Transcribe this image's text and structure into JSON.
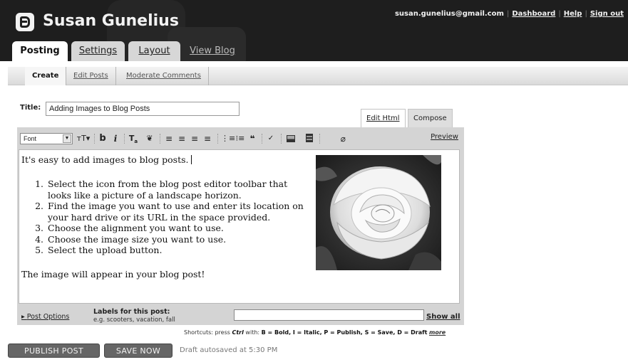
{
  "header": {
    "blog_title": "Susan Gunelius",
    "email": "susan.gunelius@gmail.com",
    "links": [
      "Dashboard",
      "Help",
      "Sign out"
    ]
  },
  "tabs": [
    "Posting",
    "Settings",
    "Layout",
    "View Blog"
  ],
  "subtabs": [
    "Create",
    "Edit Posts",
    "Moderate Comments"
  ],
  "title_field": {
    "label": "Title:",
    "value": "Adding Images to Blog Posts"
  },
  "editor_modes": [
    "Edit Html",
    "Compose"
  ],
  "toolbar": {
    "font": "Font",
    "preview": "Preview"
  },
  "post": {
    "intro": "It's easy to add images to blog posts.",
    "steps": [
      "Select the icon from the blog post editor toolbar that looks like a picture of a landscape horizon.",
      "Find the image you want to use and enter its location on your hard drive or its URL in the space provided.",
      "Choose the alignment you want to use.",
      "Choose the image size you want to use.",
      "Select the upload button."
    ],
    "outro": "The image will appear in your blog post!"
  },
  "bottom": {
    "post_options": "Post Options",
    "labels_title": "Labels for this post:",
    "labels_hint": "e.g. scooters, vacation, fall",
    "show_all": "Show all",
    "shortcuts_prefix": "Shortcuts: press",
    "shortcuts_key": "Ctrl",
    "shortcuts_with": "with:",
    "shortcuts_list": "B = Bold, I = Italic, P = Publish, S = Save, D = Draft",
    "more": "more"
  },
  "actions": {
    "publish": "PUBLISH POST",
    "save": "SAVE NOW",
    "autosave": "Draft autosaved at 5:30 PM"
  }
}
